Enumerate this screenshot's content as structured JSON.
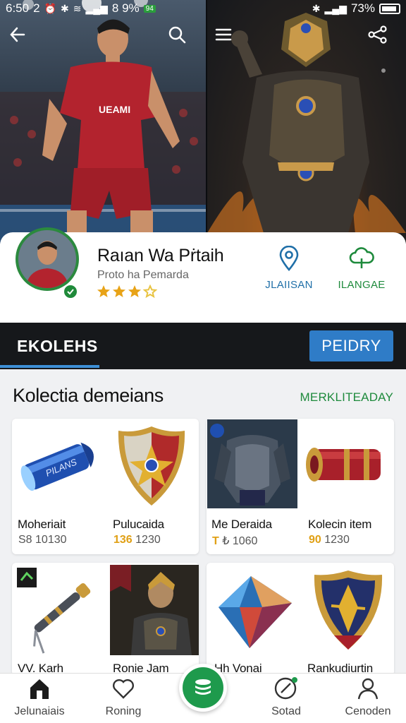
{
  "status_bar": {
    "left_time": "6:50",
    "left_mid": "2",
    "left_battery": "8 9%",
    "left_badge": "94",
    "right_battery": "73%"
  },
  "hero": {
    "back_icon": "arrow-left-icon",
    "search_icon": "search-icon",
    "menu_icon": "menu-icon",
    "share_icon": "share-icon"
  },
  "profile": {
    "name": "Raıan Wa Pṙtaih",
    "subtitle": "Proto ha Pemarda",
    "rating": 3,
    "rating_max": 4,
    "verified": true,
    "actions": [
      {
        "label": "JLAIISAN",
        "icon": "location-pin-icon"
      },
      {
        "label": "ILANGAE",
        "icon": "cloud-icon"
      }
    ]
  },
  "tabs": {
    "active_label": "EKOLEHS",
    "button_label": "PEIDRY"
  },
  "section": {
    "title": "Kolectia demeians",
    "link": "MERKLITEADAY"
  },
  "items": [
    {
      "name": "Moheriait",
      "price_prefix": "",
      "price_hl": "",
      "price": "S8 10130",
      "image": "bullet",
      "img_label": "PILANS"
    },
    {
      "name": "Pulucaida",
      "price_prefix": "",
      "price_hl": "136",
      "price": " 1230",
      "image": "shield-star"
    },
    {
      "name": "Me Deraida",
      "price_prefix": "",
      "price_hl": "T",
      "price": " ₺ 1060",
      "image": "armor"
    },
    {
      "name": "Kolecin item",
      "price_prefix": "",
      "price_hl": "90",
      "price": " 1230",
      "image": "scroll"
    },
    {
      "name": "VV. Karh",
      "price_prefix": "",
      "price_hl": "",
      "price": "",
      "image": "sword"
    },
    {
      "name": "Ronie Jam",
      "price_prefix": "",
      "price_hl": "",
      "price": "",
      "image": "warrior"
    },
    {
      "name": "Hh Vonai",
      "price_prefix": "",
      "price_hl": "",
      "price": "",
      "image": "crystal"
    },
    {
      "name": "Rankudiurtin",
      "price_prefix": "",
      "price_hl": "",
      "price": "",
      "image": "shield-gold"
    }
  ],
  "bottom_nav": [
    {
      "label": "Jelunaiais",
      "icon": "home-icon"
    },
    {
      "label": "Roning",
      "icon": "heart-icon"
    },
    {
      "label": "",
      "icon": "database-icon"
    },
    {
      "label": "Sotad",
      "icon": "compass-icon"
    },
    {
      "label": "Cenoden",
      "icon": "user-icon"
    }
  ],
  "colors": {
    "accent_green": "#1e9a4c",
    "accent_blue": "#2f7cc7",
    "link_blue": "#1f6fa8",
    "gold": "#e0a015",
    "dark_tab": "#16181b"
  }
}
